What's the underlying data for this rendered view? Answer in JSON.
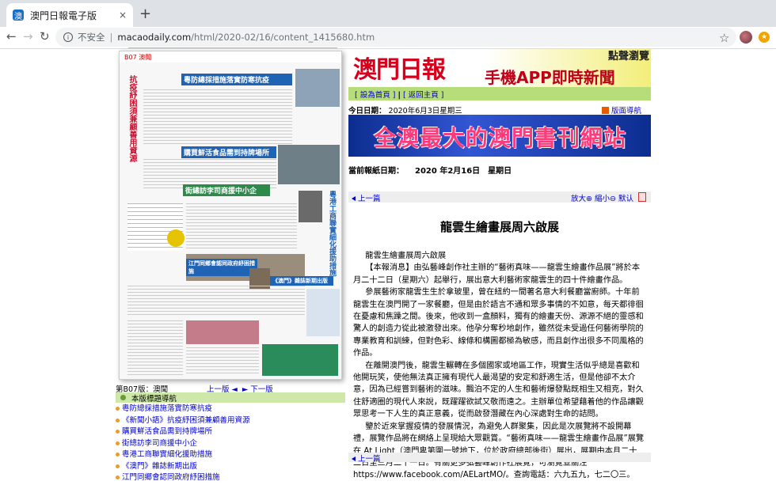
{
  "browser": {
    "tab_title": "澳門日報電子版",
    "tab_close": "×",
    "new_tab": "+",
    "security_label": "不安全",
    "url_host": "macaodaily.com",
    "url_path": "/html/2020-02/16/content_1415680.htm"
  },
  "banner": {
    "logo": "澳門日報",
    "subtitle": "手機APP即時新聞",
    "tag": "點聲瀏覽"
  },
  "linkbar": {
    "home": "[ 設為首頁 ]",
    "back": "[ 返回主頁 ]"
  },
  "today": {
    "label": "今日日期：",
    "date": "2020年6月3日星期三",
    "layout_nav": "版面導航"
  },
  "book_ad": "全澳最大的澳門書刊網站",
  "pubdate": {
    "label": "當前報紙日期：",
    "value": "2020 年2月16日　星期日"
  },
  "controls": {
    "prev": "上一篇",
    "zoom_in": "放大",
    "zoom_out": "縮小",
    "default": "默认"
  },
  "article": {
    "title": "龍雲生繪畫展周六啟展",
    "paragraphs": [
      "龍雲生繪畫展周六啟展",
      "【本報消息】由弘藝峰創作社主辦的“藝術真味——龍雲生繪畫作品展”將於本月二十二日（星期六）起舉行，展出意大利藝術家龍雲生的四十件繪畫作品。",
      "參展藝術家龍雲生生於拿玻里，曾在紐約一間著名意大利餐廳當廚師。十年前龍雲生在澳門開了一家餐廳，但是由於語言不通和眾多事情的不如意，每天都徘徊在憂慮和焦躁之間。後來，他收到一盒顏料，獨有的繪畫天份、源源不絕的靈感和驚人的創造力從此被激發出來。他孕分奪秒地創作，雖然從未受過任何藝術學院的專業教育和訓練，但對色彩、線條和構圖都極為敏感，而且創作出很多不同風格的作品。",
      "在離開澳門後，龍雲生輾轉在多個國家或地區工作，現實生活似乎總是喜歡和他開玩笑，使他無法真正擁有現代人最渴望的安定和舒適生活，但是他卻不太介意，因為已經嘗到藝術的滋味。飄泊不定的人生和藝術爆發點既相生又相克，對久住舒適圈的現代人來說，既躍躍欲試又敬而遠之。主辦單位希望藉着他的作品讓觀眾思考一下人生的真正意義，從而啟發潛藏在內心深處對生命的詰問。",
      "鑒於近來掌握疫情的發展情況，為避免人群聚集，因此是次展覽將不設開幕禮，展覽作品將在網絡上呈現給大眾觀賞。“藝術真味——龍雲生繪畫作品展”展覽在 At Light（澳門卑第圍一號地下，位於政府總部後街）展出，展期由本月二十二日至三月二十一日。有關更多弘藝峰創作社展覽，可瀏覽並關注 https://www.facebook.com/AELartMO/。查詢電話：六九五九，七二〇三。"
    ],
    "bottom_prev": "上一篇"
  },
  "page_info": {
    "page_label": "第B07版：澳聞",
    "prev_page": "上一版",
    "next_page": "下一版"
  },
  "toc": {
    "header": "本版標題導航",
    "items": [
      "粵防總採措施落實防寒抗疫",
      "《新聞小語》抗疫紓困須兼顧善用資源",
      "購買鮮活食品需到持牌場所",
      "街總訪李司商援中小企",
      "粵港工商聯實細化援助措施",
      "《澳門》雜誌新期出版",
      "江門同鄉會認同政府紓困措施"
    ]
  },
  "thumbnail": {
    "header": "B07 澳聞",
    "headline1": "粵防總採措施落實防寒抗疫",
    "headline2": "購買鮮活食品需到持牌場所",
    "headline3": "街總訪李司商援中小企",
    "headline4": "江門同鄉會認同政府紓困措施",
    "headline5": "《澳門》雜誌新期出版",
    "headline6": "粵港工商聯實細化援助措施",
    "vertical1": "抗疫紓困須兼顧善用資源",
    "colors": {
      "blue": "#1f63b5",
      "green": "#2d8a4a",
      "red": "#c8102e"
    }
  }
}
